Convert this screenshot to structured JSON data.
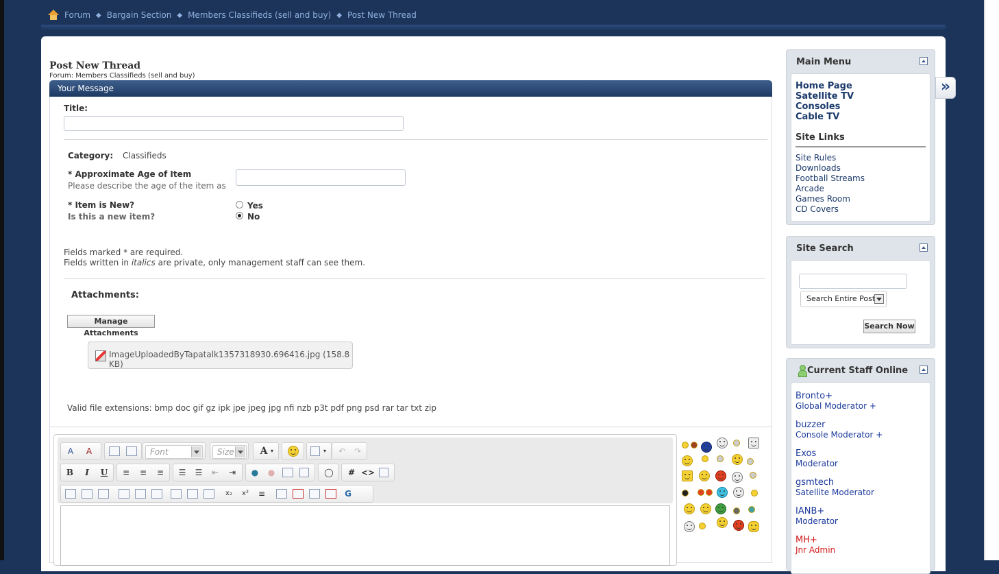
{
  "breadcrumb": [
    "Forum",
    "Bargain Section",
    "Members Classifieds (sell and buy)",
    "Post New Thread"
  ],
  "page": {
    "title": "Post New Thread",
    "forum_line": "Forum: Members Classifieds (sell and buy)",
    "section_header": "Your Message"
  },
  "form": {
    "title_label": "Title:",
    "title_value": "",
    "category_label": "Category:",
    "category_value": "Classifieds",
    "age_label": "* Approximate Age of Item",
    "age_desc": "Please describe the age of the item as",
    "age_value": "",
    "new_label": "* Item is New?",
    "new_desc": "Is this a new item?",
    "radio_yes": "Yes",
    "radio_no": "No",
    "radio_selected": "No",
    "required_note": "Fields marked * are required.",
    "private_note_pre": "Fields written in",
    "private_note_em": "italics",
    "private_note_post": "are private, only management staff can see them.",
    "attachments_label": "Attachments:",
    "manage_button": "Manage Attachments",
    "attachment_file": "ImageUploadedByTapatalk1357318930.696416.jpg (158.8 KB)",
    "valid_ext": "Valid file extensions: bmp doc gif gz ipk jpe jpeg jpg nfi nzb p3t pdf png psd rar tar txt zip"
  },
  "editor": {
    "font_placeholder": "Font",
    "size_placeholder": "Size",
    "bold": "B",
    "italic": "I",
    "underline": "U",
    "text_color": "A",
    "hash": "#",
    "code": "<>"
  },
  "sidebar": {
    "main_menu": {
      "title": "Main Menu",
      "links": [
        "Home Page",
        "Satellite TV",
        "Consoles",
        "Cable TV"
      ],
      "site_links_title": "Site Links",
      "site_links": [
        "Site Rules",
        "Downloads",
        "Football Streams",
        "Arcade",
        "Games Room",
        "CD Covers"
      ]
    },
    "search": {
      "title": "Site Search",
      "input_value": "",
      "select_value": "Search Entire Posts",
      "button": "Search Now"
    },
    "staff": {
      "title": "Current Staff Online",
      "members": [
        {
          "name": "Bronto+",
          "role": "Global Moderator +"
        },
        {
          "name": "buzzer",
          "role": "Console Moderator +"
        },
        {
          "name": "Exos",
          "role": "Moderator"
        },
        {
          "name": "gsmtech",
          "role": "Satellite Moderator"
        },
        {
          "name": "IANB+",
          "role": "Moderator"
        },
        {
          "name": "MH+",
          "role": "Jnr Admin"
        }
      ]
    }
  },
  "colors": {
    "background": "#1c3459",
    "header_bar": "#1e3a63",
    "link": "#1c3a6b",
    "admin_red": "#d01818"
  }
}
